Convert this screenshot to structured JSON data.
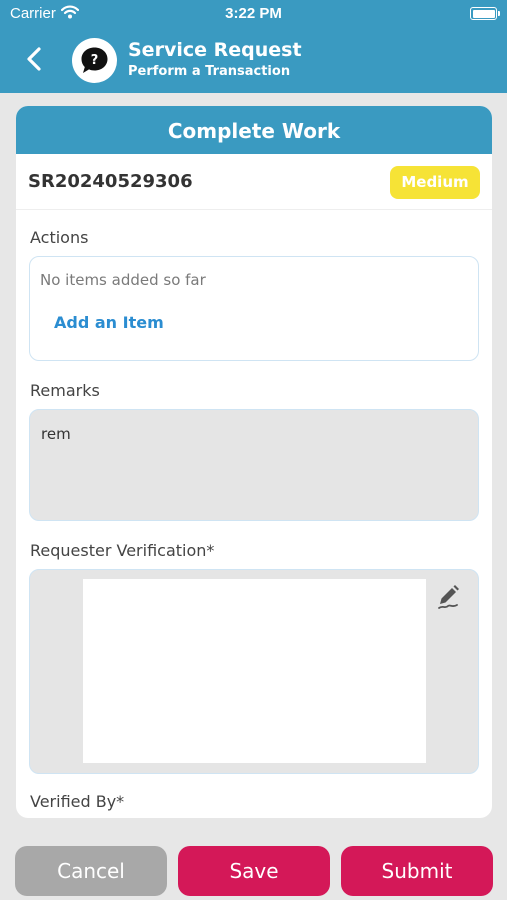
{
  "status_bar": {
    "carrier": "Carrier",
    "time": "3:22 PM"
  },
  "nav": {
    "title": "Service Request",
    "subtitle": "Perform a Transaction",
    "avatar_icon": "help-bubble-icon"
  },
  "card": {
    "heading": "Complete Work",
    "sr_number": "SR20240529306",
    "priority": "Medium",
    "priority_color": "#f6e336"
  },
  "actions": {
    "label": "Actions",
    "empty_text": "No items added so far",
    "add_link": "Add an Item"
  },
  "remarks": {
    "label": "Remarks",
    "value": "rem"
  },
  "verification": {
    "label": "Requester Verification*",
    "edit_icon": "signature-pen-icon"
  },
  "verified_by": {
    "label": "Verified By*"
  },
  "buttons": {
    "cancel": "Cancel",
    "save": "Save",
    "submit": "Submit"
  },
  "colors": {
    "header": "#3a9ac1",
    "primary_button": "#d41858",
    "cancel_button": "#a8a8a8",
    "link": "#2b8dd1"
  }
}
